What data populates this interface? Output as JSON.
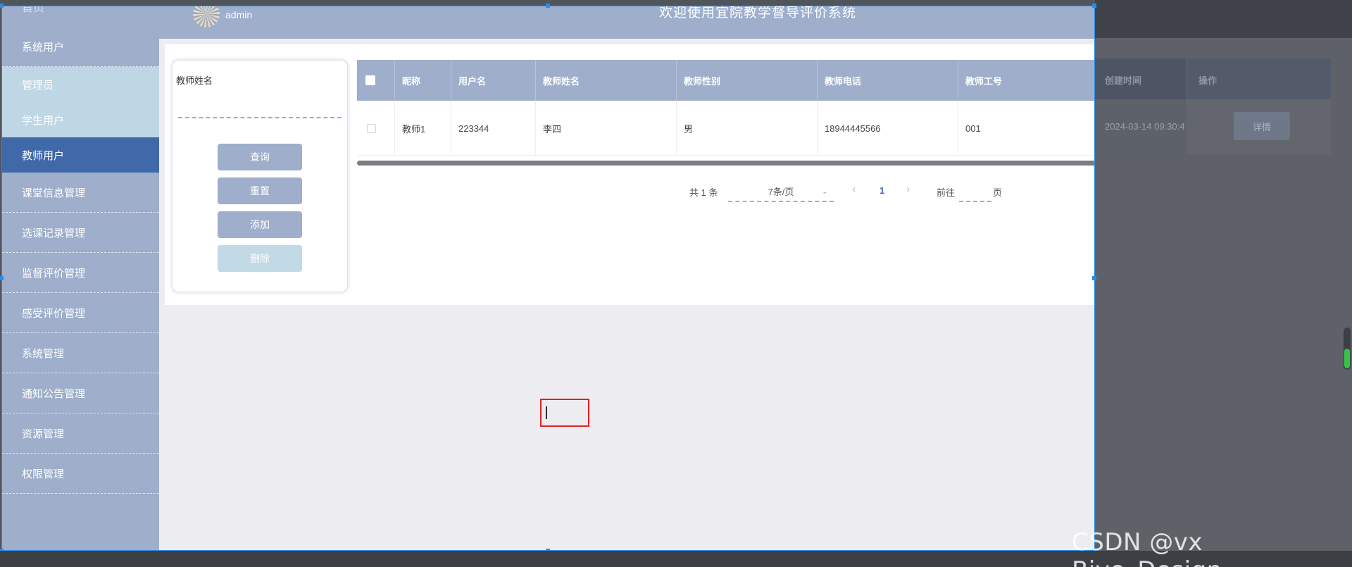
{
  "sidebar": {
    "top_title": "首页",
    "items": [
      {
        "label": "系统用户"
      },
      {
        "label": "管理员"
      },
      {
        "label": "学生用户"
      },
      {
        "label": "教师用户"
      },
      {
        "label": "课堂信息管理"
      },
      {
        "label": "选课记录管理"
      },
      {
        "label": "监督评价管理"
      },
      {
        "label": "感受评价管理"
      },
      {
        "label": "系统管理"
      },
      {
        "label": "通知公告管理"
      },
      {
        "label": "资源管理"
      },
      {
        "label": "权限管理"
      }
    ]
  },
  "header": {
    "username": "admin",
    "title": "欢迎使用宜院教学督导评价系统"
  },
  "search": {
    "label": "教师姓名",
    "value": "",
    "buttons": {
      "query": "查询",
      "reset": "重置",
      "add": "添加",
      "delete": "删除"
    }
  },
  "table": {
    "columns": [
      "昵称",
      "用户名",
      "教师姓名",
      "教师性别",
      "教师电话",
      "教师工号",
      "创建时间",
      "操作"
    ],
    "rows": [
      {
        "nickname": "教师1",
        "username": "223344",
        "teacher_name": "李四",
        "gender": "男",
        "phone": "18944445566",
        "teacher_no": "001",
        "created": "2024-03-14 09:30:4",
        "action": "详情"
      }
    ]
  },
  "pagination": {
    "total": "共 1 条",
    "page_size": "7条/页",
    "current_page": "1",
    "goto_prefix": "前往",
    "goto_suffix": "页"
  },
  "watermark": "CSDN @vx  Biye_Design",
  "colors": {
    "primary": "#9eaecb",
    "active": "#3f69a8",
    "sub_item": "#bfd6e4",
    "disabled_button": "#c2d9e6"
  }
}
